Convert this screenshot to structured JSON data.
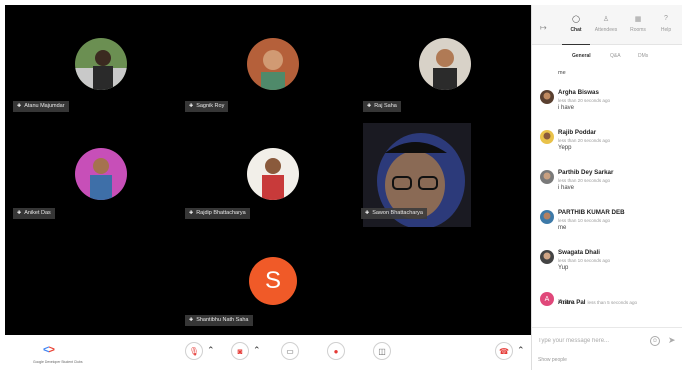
{
  "participants": [
    {
      "name": "Atanu Majumdar"
    },
    {
      "name": "Sagnik Roy"
    },
    {
      "name": "Raj Saha"
    },
    {
      "name": "Aniket Das"
    },
    {
      "name": "Rajdip Bhattacharya"
    },
    {
      "name": "Sawon Bhattacharya"
    },
    {
      "name": "Shantibhu Nath Saha",
      "initial": "S"
    }
  ],
  "toolbar": {
    "logo_mark": "<>",
    "logo_caption": "Google Developer Student Clubs"
  },
  "panel": {
    "tabs": [
      {
        "label": "Chat",
        "icon": "chat-bubble-icon"
      },
      {
        "label": "Attendees",
        "icon": "people-icon"
      },
      {
        "label": "Rooms",
        "icon": "grid-icon"
      },
      {
        "label": "Help",
        "icon": "help-icon"
      }
    ],
    "subtabs": [
      "General",
      "Q&A",
      "DMs"
    ],
    "first_line": "me",
    "messages": [
      {
        "name": "Argha Biswas",
        "time": "less than 20 seconds ago",
        "text": "i have"
      },
      {
        "name": "Rajib Poddar",
        "time": "less than 20 seconds ago",
        "text": "Yepp"
      },
      {
        "name": "Parthib Dey Sarkar",
        "time": "less than 20 seconds ago",
        "text": "i have"
      },
      {
        "name": "PARTHIB KUMAR DEB",
        "time": "less than 10 seconds ago",
        "text": "me"
      },
      {
        "name": "Swagata Dhali",
        "time": "less than 10 seconds ago",
        "text": "Yup"
      },
      {
        "name": "Aritra Pal",
        "time": "less than 5 seconds ago",
        "text": "i have",
        "initial": "A"
      }
    ],
    "composer_placeholder": "Type your message here...",
    "footer": "Show people"
  },
  "colors": {
    "stage": "#000000",
    "s_avatar": "#f05a28",
    "aritra_avatar": "#e0487a"
  }
}
